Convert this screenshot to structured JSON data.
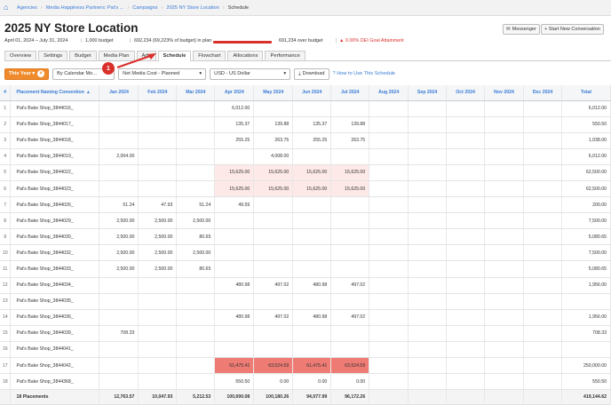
{
  "breadcrumb": [
    "Agencies",
    "Media Happiness Partners: Pat's ...",
    "Campaigns",
    "2025 NY Store Location",
    "Schedule"
  ],
  "title": "2025 NY Store Location",
  "buttons": {
    "messenger": "Messenger",
    "new_conversation": "+ Start New Conversation"
  },
  "summary": {
    "dates": "April 01, 2024 – July 31, 2024",
    "budget": "1,000 budget",
    "in_plan": "692,234 (69,223% of budget) in plan",
    "over_budget": "691,234 over budget",
    "dei": "0.00% DEI Goal Attainment"
  },
  "tabs": [
    "Overview",
    "Settings",
    "Budget",
    "Media Plan",
    "Ads",
    "Schedule",
    "Flowchart",
    "Allocations",
    "Performance"
  ],
  "filters": {
    "period": "This Year",
    "grouping": "By Calendar Mo...",
    "cost": "Net Media Cost - Planned",
    "currency": "USD - US Dollar",
    "download": "Download",
    "help": "How to Use This Schedule"
  },
  "callout": "1",
  "table": {
    "headers": [
      "#",
      "Placement Naming Convention",
      "Jan 2024",
      "Feb 2024",
      "Mar 2024",
      "Apr 2024",
      "May 2024",
      "Jun 2024",
      "Jul 2024",
      "Aug 2024",
      "Sep 2024",
      "Oct 2024",
      "Nov 2024",
      "Dec 2024",
      "Total"
    ],
    "rows": [
      [
        "1",
        "Pat's Bake Shop_3844016_",
        "",
        "",
        "",
        "6,012.00",
        "",
        "",
        "",
        "",
        "",
        "",
        "",
        "",
        "6,012.00"
      ],
      [
        "2",
        "Pat's Bake Shop_3844017_",
        "",
        "",
        "",
        "135.37",
        "139.88",
        "135.37",
        "139.88",
        "",
        "",
        "",
        "",
        "",
        "550.50"
      ],
      [
        "3",
        "Pat's Bake Shop_3844018_",
        "",
        "",
        "",
        "255.25",
        "263.75",
        "255.25",
        "263.75",
        "",
        "",
        "",
        "",
        "",
        "1,038.00"
      ],
      [
        "4",
        "Pat's Bake Shop_3844019_",
        "2,004.00",
        "",
        "",
        "",
        "4,008.00",
        "",
        "",
        "",
        "",
        "",
        "",
        "",
        "6,012.00"
      ],
      [
        "5",
        "Pat's Bake Shop_3844022_",
        "",
        "",
        "",
        "15,625.00",
        "15,625.00",
        "15,625.00",
        "15,625.00",
        "",
        "",
        "",
        "",
        "",
        "62,500.00"
      ],
      [
        "6",
        "Pat's Bake Shop_3844023_",
        "",
        "",
        "",
        "15,625.00",
        "15,625.00",
        "15,625.00",
        "15,625.00",
        "",
        "",
        "",
        "",
        "",
        "62,500.00"
      ],
      [
        "7",
        "Pat's Bake Shop_3844026_",
        "51.24",
        "47.93",
        "51.24",
        "49.59",
        "",
        "",
        "",
        "",
        "",
        "",
        "",
        "",
        "200.00"
      ],
      [
        "8",
        "Pat's Bake Shop_3844029_",
        "2,500.00",
        "2,500.00",
        "2,500.00",
        "",
        "",
        "",
        "",
        "",
        "",
        "",
        "",
        "",
        "7,500.00"
      ],
      [
        "9",
        "Pat's Bake Shop_3844030_",
        "2,500.00",
        "2,500.00",
        "80.65",
        "",
        "",
        "",
        "",
        "",
        "",
        "",
        "",
        "",
        "5,080.65"
      ],
      [
        "10",
        "Pat's Bake Shop_3844032_",
        "2,500.00",
        "2,500.00",
        "2,500.00",
        "",
        "",
        "",
        "",
        "",
        "",
        "",
        "",
        "",
        "7,500.00"
      ],
      [
        "11",
        "Pat's Bake Shop_3844033_",
        "2,500.00",
        "2,500.00",
        "80.65",
        "",
        "",
        "",
        "",
        "",
        "",
        "",
        "",
        "",
        "5,080.65"
      ],
      [
        "12",
        "Pat's Bake Shop_3844034_",
        "",
        "",
        "",
        "480.98",
        "497.02",
        "480.98",
        "497.02",
        "",
        "",
        "",
        "",
        "",
        "1,956.00"
      ],
      [
        "13",
        "Pat's Bake Shop_3844035_",
        "",
        "",
        "",
        "",
        "",
        "",
        "",
        "",
        "",
        "",
        "",
        "",
        ""
      ],
      [
        "14",
        "Pat's Bake Shop_3844036_",
        "",
        "",
        "",
        "480.98",
        "497.02",
        "480.98",
        "497.02",
        "",
        "",
        "",
        "",
        "",
        "1,956.00"
      ],
      [
        "15",
        "Pat's Bake Shop_3844039_",
        "708.33",
        "",
        "",
        "",
        "",
        "",
        "",
        "",
        "",
        "",
        "",
        "",
        "708.33"
      ],
      [
        "16",
        "Pat's Bake Shop_3844041_",
        "",
        "",
        "",
        "",
        "",
        "",
        "",
        "",
        "",
        "",
        "",
        "",
        ""
      ],
      [
        "17",
        "Pat's Bake Shop_3844042_",
        "",
        "",
        "",
        "61,475.41",
        "63,524.59",
        "61,475.41",
        "63,524.59",
        "",
        "",
        "",
        "",
        "",
        "250,000.00"
      ],
      [
        "18",
        "Pat's Bake Shop_3844368_",
        "",
        "",
        "",
        "550.50",
        "0.00",
        "0.00",
        "0.00",
        "",
        "",
        "",
        "",
        "",
        "550.50"
      ]
    ],
    "highlight_pink_rows": [
      4,
      5
    ],
    "highlight_red_row": 16,
    "footer": [
      "",
      "18 Placements",
      "12,763.57",
      "10,047.93",
      "5,212.53",
      "100,690.08",
      "100,180.26",
      "94,077.99",
      "96,172.26",
      "",
      "",
      "",
      "",
      "",
      "419,144.62"
    ]
  },
  "colors": {
    "accent": "#3a7bd5",
    "orange": "#ef8b2c",
    "red": "#d9302c",
    "pink": "#fde9e7",
    "red_cell": "#ee7b74"
  }
}
